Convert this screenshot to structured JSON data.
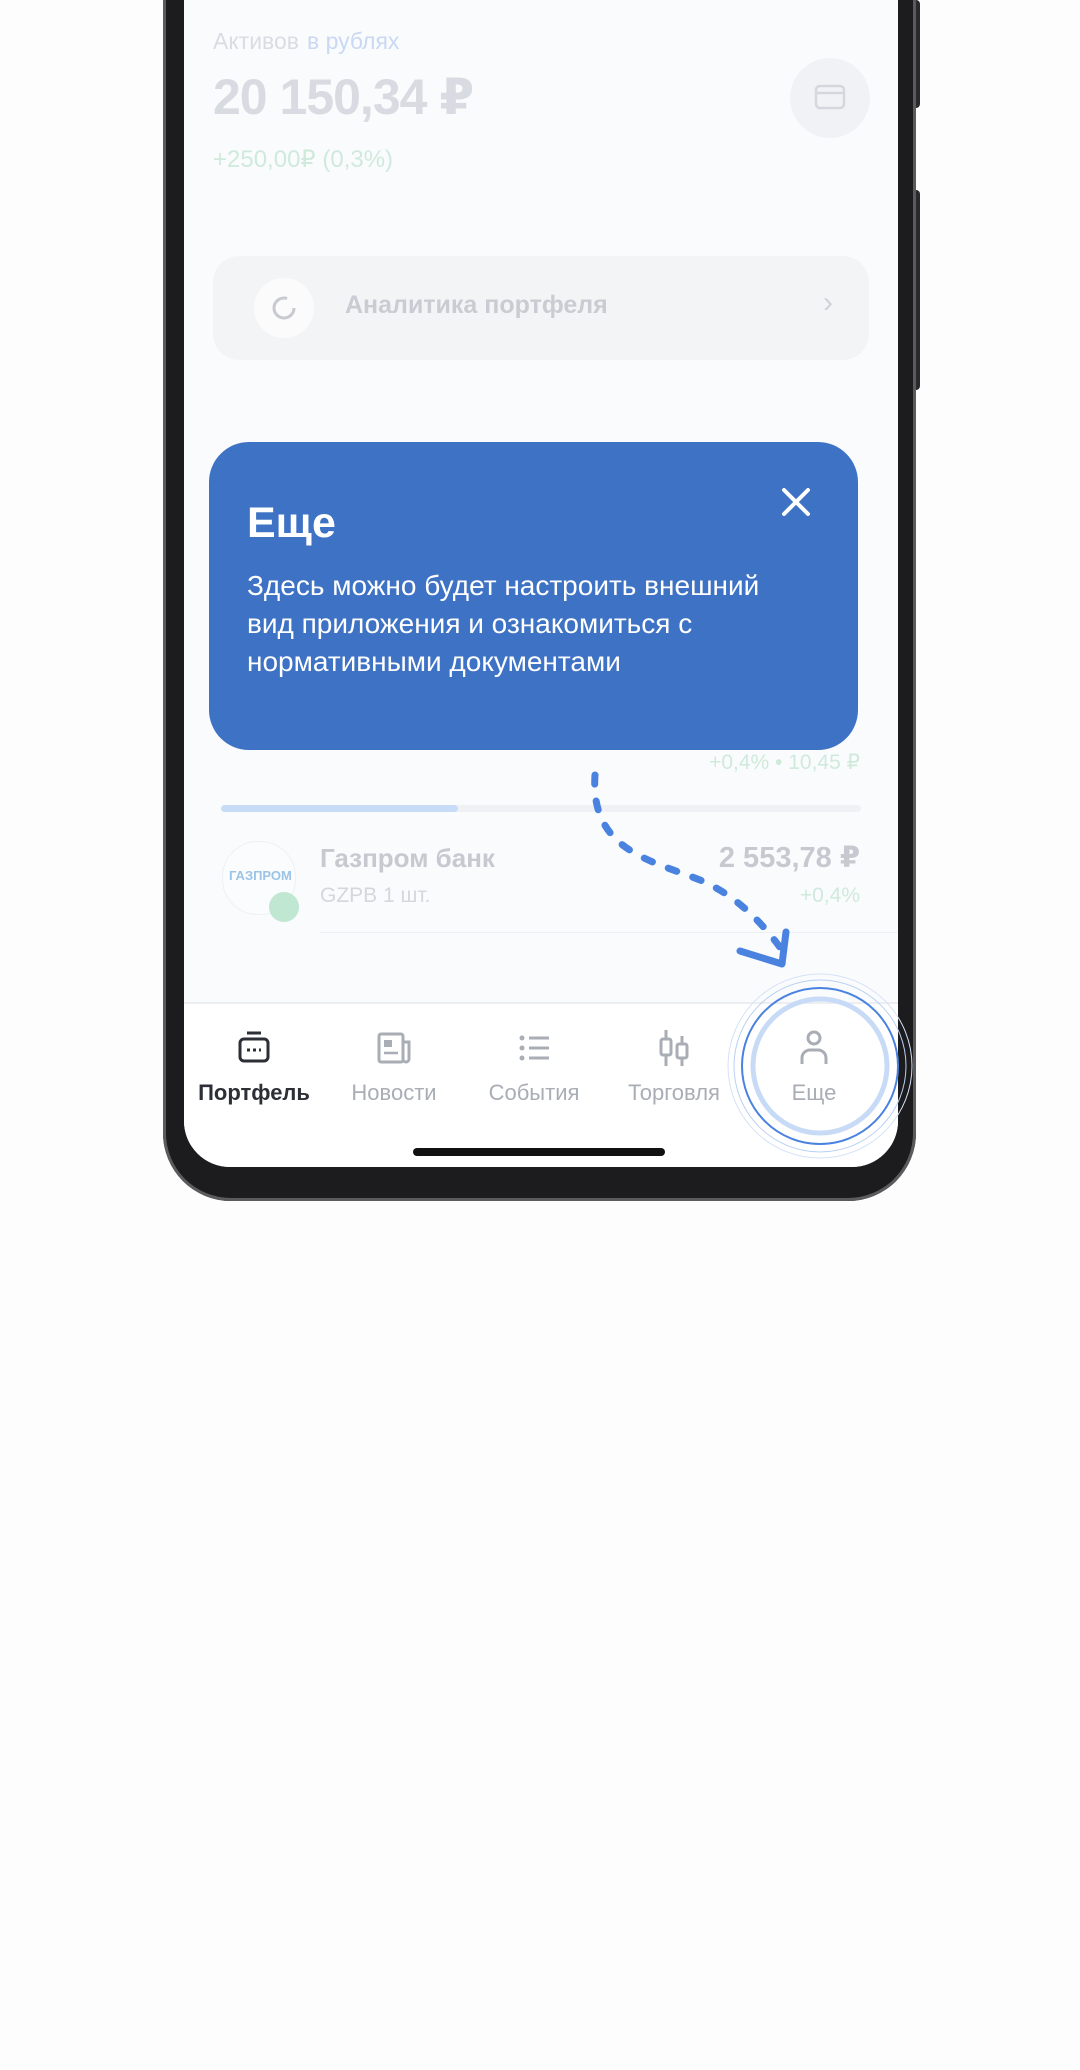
{
  "portfolio": {
    "assets_label": "Активов",
    "currency_label": "в рублях",
    "total_value": "20 150,34 ₽",
    "change": "+250,00₽ (0,3%)",
    "analytics_label": "Аналитика портфеля",
    "prev_row_change": "+0,4% • 10,45 ₽",
    "progress_fraction": 0.37
  },
  "stock": {
    "logo_text": "ГАЗПРОМ",
    "name": "Газпром банк",
    "ticker": "GZPB 1 шт.",
    "value": "2 553,78 ₽",
    "change": "+0,4%"
  },
  "tooltip": {
    "title": "Еще",
    "body": "Здесь можно будет настроить внешний вид приложения и ознакомиться с нормативными документами"
  },
  "tabs": [
    {
      "label": "Портфель",
      "icon": "briefcase-icon",
      "active": true
    },
    {
      "label": "Новости",
      "icon": "newspaper-icon",
      "active": false
    },
    {
      "label": "События",
      "icon": "list-icon",
      "active": false
    },
    {
      "label": "Торговля",
      "icon": "candlestick-icon",
      "active": false
    },
    {
      "label": "Еще",
      "icon": "person-icon",
      "active": false
    }
  ],
  "colors": {
    "accent": "#3d72c4",
    "arrow": "#4a82e0",
    "positive": "#cfeadb"
  }
}
